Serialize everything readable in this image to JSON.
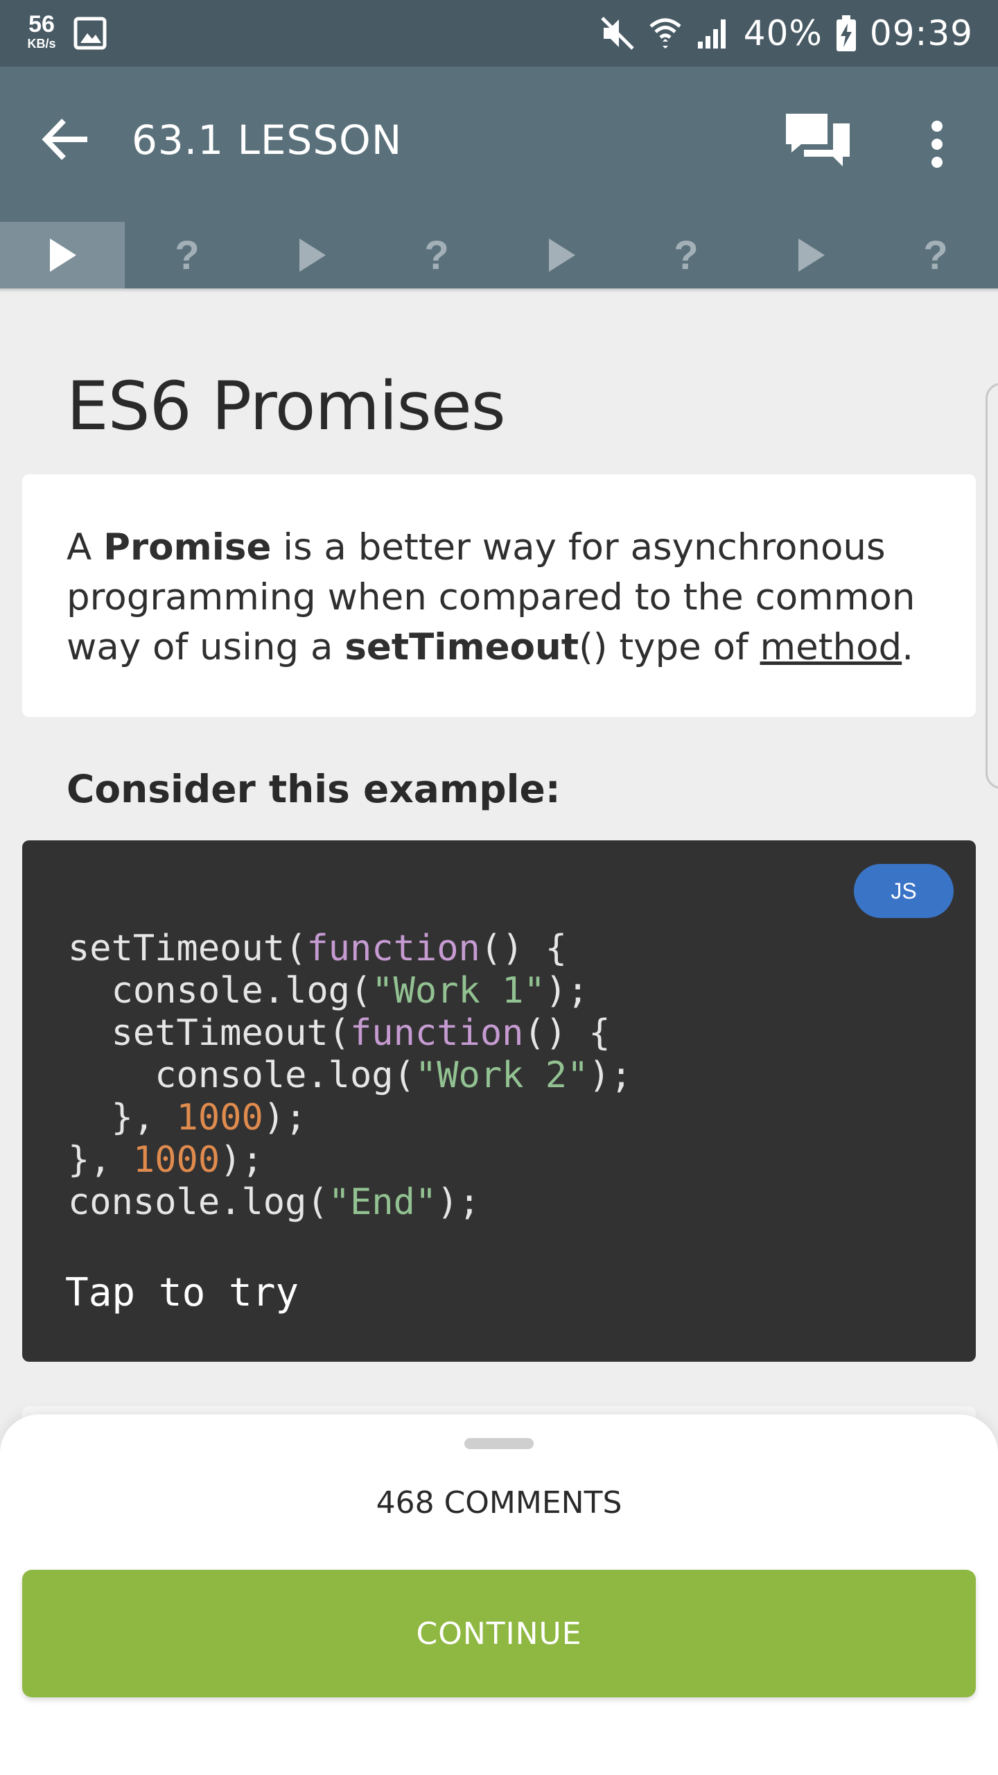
{
  "status_bar": {
    "net_speed_value": "56",
    "net_speed_unit": "KB/s",
    "battery": "40%",
    "time": "09:39",
    "icons": [
      "gallery-icon",
      "mute-icon",
      "wifi-icon",
      "signal-icon",
      "battery-charging-icon"
    ]
  },
  "toolbar": {
    "title": "63.1 LESSON",
    "icons": [
      "back-arrow-icon",
      "comments-icon",
      "more-vert-icon"
    ]
  },
  "progress_steps": [
    {
      "type": "play",
      "label": "",
      "active": true
    },
    {
      "type": "quiz",
      "label": "?",
      "active": false
    },
    {
      "type": "play",
      "label": "",
      "active": false
    },
    {
      "type": "quiz",
      "label": "?",
      "active": false
    },
    {
      "type": "play",
      "label": "",
      "active": false
    },
    {
      "type": "quiz",
      "label": "?",
      "active": false
    },
    {
      "type": "play",
      "label": "",
      "active": false
    },
    {
      "type": "quiz",
      "label": "?",
      "active": false
    }
  ],
  "lesson": {
    "heading": "ES6 Promises",
    "intro": {
      "part1": "A ",
      "bold1": "Promise",
      "part2": " is a better way for asynchronous programming when compared to the common way of using a ",
      "bold2": "setTimeout",
      "part3": "() type of ",
      "link": "method",
      "part4": "."
    },
    "example_heading": "Consider this example:"
  },
  "code_block": {
    "language_badge": "JS",
    "tap_label": "Tap to try"
  },
  "sheet": {
    "comments_label": "468 COMMENTS",
    "continue_label": "CONTINUE"
  },
  "colors": {
    "status_bar": "#485a64",
    "toolbar": "#5a707b",
    "code_bg": "#323232",
    "badge": "#3a74c6",
    "continue": "#8fb842"
  }
}
